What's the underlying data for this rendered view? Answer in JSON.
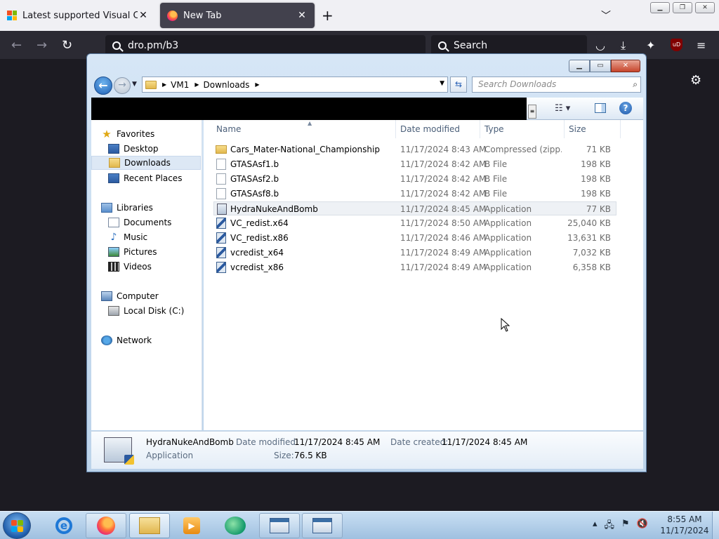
{
  "browser": {
    "tabs": [
      {
        "title": "Latest supported Visual C++ Re",
        "close": "✕"
      },
      {
        "title": "New Tab",
        "close": "✕"
      }
    ],
    "url": "dro.pm/b3",
    "search_placeholder": "Search",
    "ublock_label": "uD"
  },
  "explorer": {
    "breadcrumb": [
      "VM1",
      "Downloads"
    ],
    "search_placeholder": "Search Downloads",
    "nav": {
      "favorites": {
        "label": "Favorites",
        "items": [
          "Desktop",
          "Downloads",
          "Recent Places"
        ]
      },
      "libraries": {
        "label": "Libraries",
        "items": [
          "Documents",
          "Music",
          "Pictures",
          "Videos"
        ]
      },
      "computer": {
        "label": "Computer",
        "items": [
          "Local Disk (C:)"
        ]
      },
      "network": {
        "label": "Network"
      }
    },
    "columns": {
      "name": "Name",
      "date": "Date modified",
      "type": "Type",
      "size": "Size"
    },
    "files": [
      {
        "name": "Cars_Mater-National_Championship",
        "date": "11/17/2024 8:43 AM",
        "type": "Compressed (zipp...",
        "size": "71 KB"
      },
      {
        "name": "GTASAsf1.b",
        "date": "11/17/2024 8:42 AM",
        "type": "B File",
        "size": "198 KB"
      },
      {
        "name": "GTASAsf2.b",
        "date": "11/17/2024 8:42 AM",
        "type": "B File",
        "size": "198 KB"
      },
      {
        "name": "GTASAsf8.b",
        "date": "11/17/2024 8:42 AM",
        "type": "B File",
        "size": "198 KB"
      },
      {
        "name": "HydraNukeAndBomb",
        "date": "11/17/2024 8:45 AM",
        "type": "Application",
        "size": "77 KB"
      },
      {
        "name": "VC_redist.x64",
        "date": "11/17/2024 8:50 AM",
        "type": "Application",
        "size": "25,040 KB"
      },
      {
        "name": "VC_redist.x86",
        "date": "11/17/2024 8:46 AM",
        "type": "Application",
        "size": "13,631 KB"
      },
      {
        "name": "vcredist_x64",
        "date": "11/17/2024 8:49 AM",
        "type": "Application",
        "size": "7,032 KB"
      },
      {
        "name": "vcredist_x86",
        "date": "11/17/2024 8:49 AM",
        "type": "Application",
        "size": "6,358 KB"
      }
    ],
    "details": {
      "name": "HydraNukeAndBomb",
      "type": "Application",
      "modified_label": "Date modified:",
      "modified_value": "11/17/2024 8:45 AM",
      "created_label": "Date created:",
      "created_value": "11/17/2024 8:45 AM",
      "size_label": "Size:",
      "size_value": "76.5 KB"
    }
  },
  "taskbar": {
    "clock_time": "8:55 AM",
    "clock_date": "11/17/2024"
  }
}
